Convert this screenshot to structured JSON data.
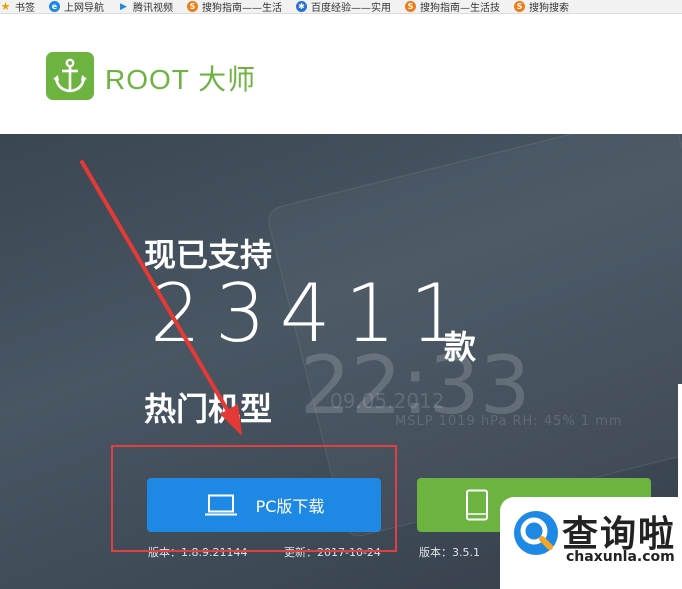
{
  "bookmarks_bar": {
    "items": [
      {
        "label": "书签",
        "icon": "star-icon"
      },
      {
        "label": "上网导航",
        "icon": "ie-icon"
      },
      {
        "label": "腾讯视频",
        "icon": "play-icon"
      },
      {
        "label": "搜狗指南——生活",
        "icon": "sogou-icon"
      },
      {
        "label": "百度经验——实用",
        "icon": "baidu-paw-icon"
      },
      {
        "label": "搜狗指南—生活技",
        "icon": "sogou-icon"
      },
      {
        "label": "搜狗搜索",
        "icon": "sogou-icon"
      }
    ]
  },
  "header": {
    "brand": "ROOT 大师",
    "logo_icon": "anchor-icon",
    "brand_color": "#6cb33f"
  },
  "hero": {
    "line1": "现已支持",
    "count": "23411",
    "unit": "款",
    "line2": "热门机型",
    "background_time": "22:33",
    "background_date": "09.05.2012",
    "background_stat": "MSLP 1019 hPa RH: 45% 1 mm"
  },
  "downloads": {
    "pc_button_label": "PC版下载",
    "pc_icon": "laptop-icon",
    "pc_color": "#1e88e5",
    "mobile_icon": "phone-icon",
    "mobile_color": "#6cb33f",
    "pc_version": "版本：1.8.9.21144",
    "pc_update": "更新：2017-10-24",
    "mobile_version": "版本：3.5.1"
  },
  "annotation": {
    "highlight_color": "#e04040"
  },
  "watermark": {
    "title": "查询啦",
    "domain": "chaxunla.com"
  }
}
